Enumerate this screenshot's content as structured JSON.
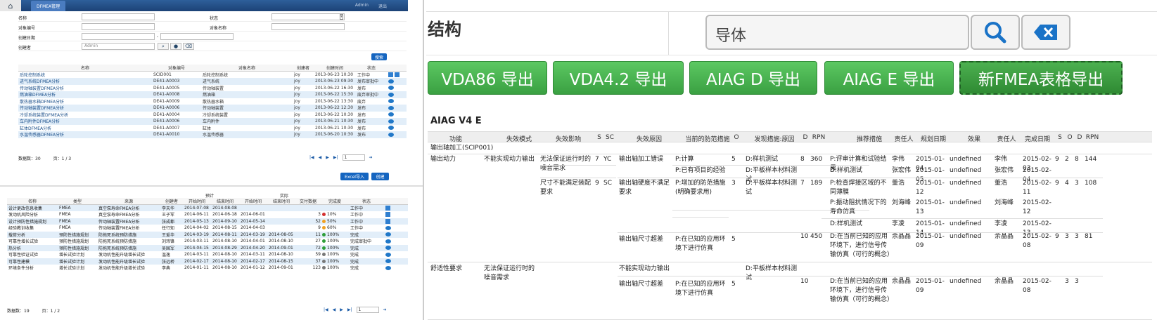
{
  "left": {
    "topbar": {
      "tab": "DFMEA管理",
      "links": [
        "Admin",
        "退出"
      ]
    },
    "form": {
      "name_label": "名称",
      "status_label": "状态",
      "objno_label": "对象编号",
      "objname_label": "对象名称",
      "date_label": "创建日期",
      "date_sep": "-",
      "creator_label": "创建者",
      "creator_value": "Admin",
      "search_btn": "搜索"
    },
    "table1": {
      "headers": [
        "名称",
        "对象编号",
        "对象名称",
        "创建者",
        "创建时间",
        "状态"
      ],
      "rows": [
        [
          "后轮控制系统",
          "SCID001",
          "后轮控制系统",
          "joy",
          "2013-06-23 10:30",
          "工作中"
        ],
        [
          "进气系统DFMEA分析",
          "DE41-A0003",
          "进气系统",
          "joy",
          "2013-06-23 09:30",
          "发布审批中"
        ],
        [
          "传动轴装置DFMEA分析",
          "DE41-A0005",
          "传动轴装置",
          "joy",
          "2013-06-22 16:30",
          "发布"
        ],
        [
          "燃油箱DFMEA分析",
          "DE41-A0008",
          "燃油箱",
          "joy",
          "2013-06-22 15:30",
          "废弃审批中"
        ],
        [
          "散热器水箱DFMEA分析",
          "DE41-A0009",
          "散热器水箱",
          "joy",
          "2013-06-22 13:30",
          "废弃"
        ],
        [
          "传动轴装置DFMEA分析",
          "DE41-A0006",
          "传动轴装置",
          "joy",
          "2013-06-22 12:30",
          "发布"
        ],
        [
          "冷却系统装置DFMEA分析",
          "DE41-A0004",
          "冷却系统装置",
          "joy",
          "2013-06-22 10:30",
          "发布"
        ],
        [
          "车内附件DFMEA分析",
          "DE41-A0006",
          "车内附件",
          "joy",
          "2013-06-21 10:30",
          "发布"
        ],
        [
          "缸体DFMEA分析",
          "DE41-A0007",
          "缸体",
          "joy",
          "2013-06-21 10:30",
          "发布"
        ],
        [
          "水温传感器DFMEA分析",
          "DE41-A0010",
          "水温传感器",
          "joy",
          "2013-06-20 10:30",
          "发布"
        ]
      ],
      "count": "数据数：30",
      "page": "页：1 / 3",
      "page_input": "1"
    },
    "btn_excel": "Excel导入",
    "btn_create": "创建",
    "table2": {
      "group_plan": "预计",
      "group_actual": "实际",
      "headers": [
        "名称",
        "类型",
        "来源",
        "创建者",
        "开始时间",
        "结束时间",
        "开始时间",
        "结束时间",
        "交付数据",
        "完成度",
        "状态"
      ],
      "rows": [
        [
          "设计更改信息收集",
          "FMEA",
          "真空泵寿命FMEA分析",
          "李天华",
          "2014-07-08",
          "2014-08-08",
          "",
          "",
          "",
          "",
          "工作中",
          ""
        ],
        [
          "发动机风险分析",
          "FMEA",
          "真空泵寿命FMEA分析",
          "王子军",
          "2014-06-11",
          "2014-06-18",
          "2014-06-01",
          "",
          "3",
          "10%",
          "工作中",
          "#d32f2f"
        ],
        [
          "设计预防性措施规划",
          "FMEA",
          "传动轴装置FMEA分析",
          "张成都",
          "2014-05-13",
          "2014-09-10",
          "2014-05-14",
          "",
          "52",
          "50%",
          "工作中",
          "#f0a020"
        ],
        [
          "经验教训收集",
          "FMEA",
          "传动轴装置FMEA分析",
          "任行知",
          "2014-04-02",
          "2014-08-15",
          "2014-04-03",
          "",
          "9",
          "60%",
          "工作中",
          "#f0a020"
        ],
        [
          "载荷分析",
          "预防性措施规划",
          "防拖死系统预防措施",
          "王爱华",
          "2014-03-19",
          "2014-08-11",
          "2014-03-19",
          "2014-08-05",
          "11",
          "100%",
          "完成",
          "#2e9e3a"
        ],
        [
          "可靠性增长试验",
          "预防性措施规划",
          "防拖死系统预防措施",
          "刘玮锋",
          "2014-03-11",
          "2014-08-10",
          "2014-04-01",
          "2014-08-10",
          "27",
          "100%",
          "完成审批中",
          "#2e9e3a"
        ],
        [
          "热分析",
          "预防性措施规划",
          "防拖死系统预防措施",
          "吴国军",
          "2014-04-15",
          "2014-08-29",
          "2014-04-20",
          "2014-09-01",
          "72",
          "100%",
          "完成",
          "#2e9e3a"
        ],
        [
          "可靠性验证试验",
          "增长试验计划",
          "发动机性能升级增长试验",
          "温逸",
          "2014-03-11",
          "2014-08-10",
          "2014-03-11",
          "2014-08-10",
          "59",
          "100%",
          "完成",
          "#777777"
        ],
        [
          "可靠性建模",
          "增长试验计划",
          "发动机性能升级增长试验",
          "张远桥",
          "2014-02-17",
          "2014-08-10",
          "2014-02-17",
          "2014-08-15",
          "37",
          "100%",
          "完成",
          "#777777"
        ],
        [
          "环境条件分析",
          "增长试验计划",
          "发动机性能升级增长试验",
          "李典",
          "2014-01-11",
          "2014-08-10",
          "2014-01-12",
          "2014-09-01",
          "123",
          "100%",
          "完成",
          "#777777"
        ]
      ],
      "count": "数据数：19",
      "page": "页：1 / 2",
      "page_input": "1"
    }
  },
  "right": {
    "title": "结构",
    "search_value": "导体",
    "export_buttons": [
      "VDA86 导出",
      "VDA4.2 导出",
      "AIAG D 导出",
      "AIAG E 导出",
      "新FMEA表格导出"
    ],
    "aiag": {
      "caption": "AIAG V4 E",
      "headers": [
        "功能",
        "失效模式",
        "失效影响",
        "S",
        "SC",
        "失效原因",
        "当前的防范措施",
        "O",
        "发现措施:原因",
        "D",
        "RPN",
        "推荐措施",
        "责任人",
        "规划日期",
        "效果",
        "责任人",
        "完成日期",
        "S",
        "O",
        "D",
        "RPN"
      ],
      "group": "输出轴加工(SCIP001)",
      "c1": {
        "func": "输出动力",
        "mode": "不能实现动力输出",
        "e1": "无法保证运行时的噪音需求",
        "e1s": "7",
        "e1sc": "YC",
        "e2": "尺寸不能满足装配要求",
        "e2s": "9",
        "e2sc": "SC",
        "cause1": "输出轴加工错误",
        "p1a": "P:计算",
        "p1b": "P:已有项目的经验",
        "o1": "5",
        "d1a": "D:样机测试",
        "d1b": "D:平板样本材料测试",
        "dd1": "8",
        "rpn1": "360",
        "r1a": "P:评审计算和试验结果",
        "r1a_who": "李伟",
        "r1a_date": "2015-01-04",
        "r1a_eff": "undefined",
        "r1a_who2": "李伟",
        "r1a_done": "2015-02-03",
        "r1_s": "9",
        "r1_o": "2",
        "r1_d": "8",
        "r1_rpn": "144",
        "r1b": "D:样机测试",
        "r1b_who": "张宏伟",
        "r1b_date": "2015-01-05",
        "r1b_eff": "undefined",
        "r1b_who2": "张宏伟",
        "r1b_done": "2015-02-04",
        "cause2": "输出轴硬度不满足要求",
        "p2": "P:增加的防范措施(明确要求用)",
        "o2": "3",
        "d2": "D:平板样本材料测试",
        "dd2": "7",
        "rpn2": "189",
        "r2a": "P:检查焊接区域的不同薄膜",
        "r2a_who": "董浩",
        "r2a_date": "2015-01-12",
        "r2a_eff": "undefined",
        "r2a_who2": "董浩",
        "r2a_done": "2015-02-11",
        "r2_s": "9",
        "r2_o": "4",
        "r2_d": "3",
        "r2_rpn": "108",
        "r2b": "P:振动阻抗情况下的寿命仿真",
        "r2b_who": "刘海峰",
        "r2b_date": "2015-01-13",
        "r2b_eff": "undefined",
        "r2b_who2": "刘海峰",
        "r2b_done": "2015-02-12",
        "r2c": "D:样机测试",
        "r2c_who": "李凌",
        "r2c_date": "2015-01-14",
        "r2c_eff": "undefined",
        "r2c_who2": "李凌",
        "r2c_done": "2015-02-13",
        "cause3": "输出轴尺寸超差",
        "p3": "P:在已知的应用环境下进行仿真",
        "o3": "5",
        "dd3": "10",
        "rpn3": "450",
        "r3": "D:在当前已知的应用环境下，进行信号传输仿真（可行的概念）",
        "r3_who": "余晶晶",
        "r3_date": "2015-01-09",
        "r3_eff": "undefined",
        "r3_who2": "余晶晶",
        "r3_done": "2015-02-08",
        "r3_s": "9",
        "r3_o": "3",
        "r3_d": "3",
        "r3_rpn": "81"
      },
      "c2": {
        "func": "舒适性要求",
        "mode": "无法保证运行时的噪音需求",
        "cause1": "不能实现动力输出",
        "d1": "D:平板样本材料测试",
        "cause2": "输出轴尺寸超差",
        "p2": "P:在已知的应用环境下进行仿真",
        "o2": "5",
        "dd2": "10",
        "r2": "D:在当前已知的应用环境下，进行信号传输仿真（可行的概念）",
        "r2_who": "余晶晶",
        "r2_date": "2015-01-09",
        "r2_eff": "undefined",
        "r2_who2": "余晶晶",
        "r2_done": "2015-02-08",
        "r2_o": "3",
        "r2_d": "3"
      }
    }
  }
}
